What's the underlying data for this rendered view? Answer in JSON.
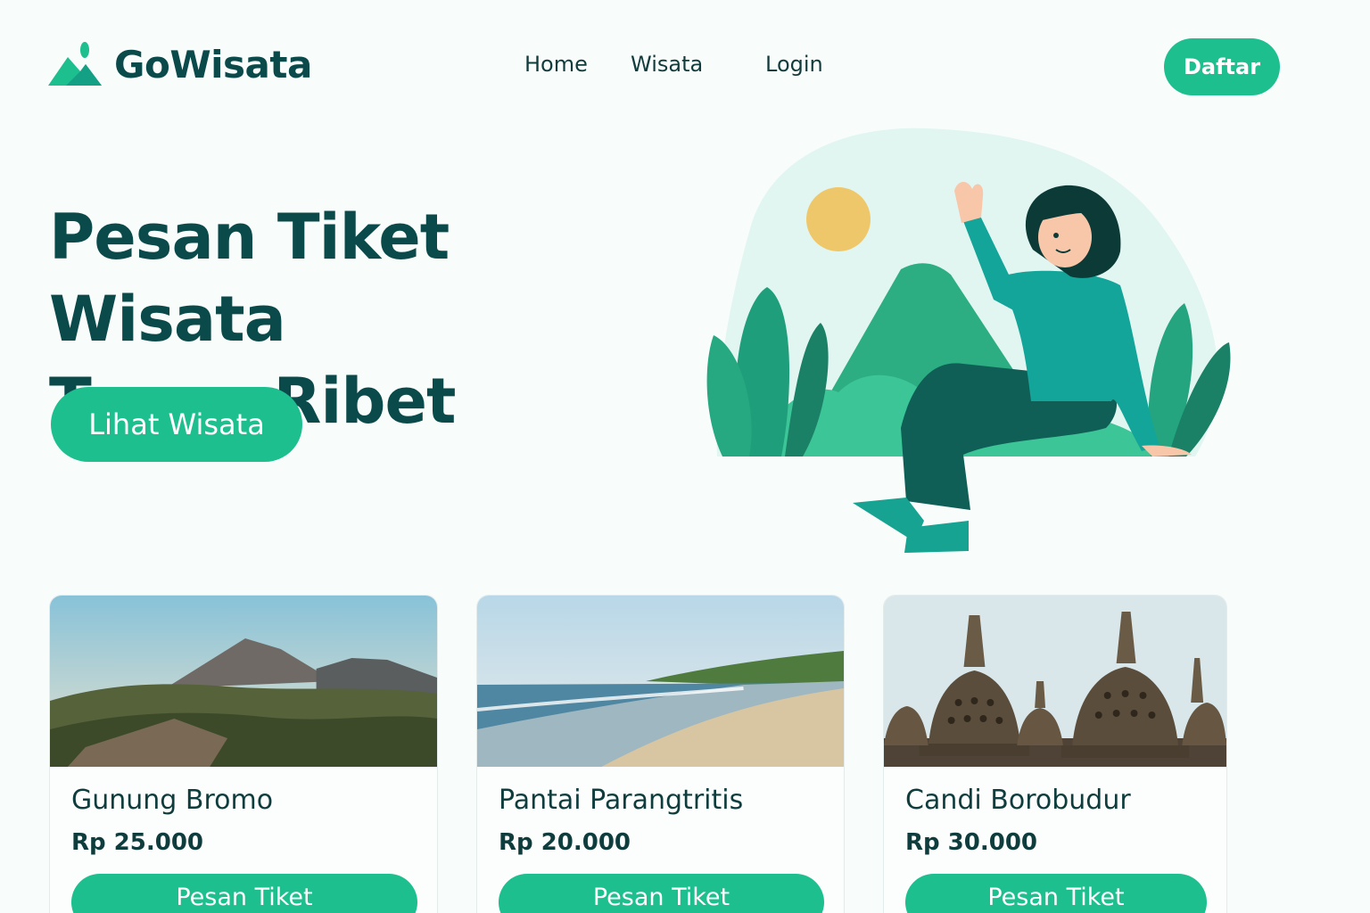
{
  "header": {
    "brand": "GoWisata",
    "nav": [
      {
        "label": "Home"
      },
      {
        "label": "Wisata"
      },
      {
        "label": "Login"
      }
    ],
    "cta_label": "Daftar"
  },
  "hero": {
    "title_line1": "Pesan Tiket Wisata",
    "title_line2": "Tanpa Ribet",
    "button_label": "Lihat Wisata"
  },
  "destinations": [
    {
      "name": "Gunung Bromo",
      "price": "Rp 25.000",
      "button": "Pesan Tiket",
      "image": "mountain-landscape"
    },
    {
      "name": "Pantai Parangtritis",
      "price": "Rp 20.000",
      "button": "Pesan Tiket",
      "image": "beach-landscape"
    },
    {
      "name": "Candi Borobudur",
      "price": "Rp 30.000",
      "button": "Pesan Tiket",
      "image": "temple-stupas"
    }
  ],
  "colors": {
    "primary": "#1dbf8e",
    "text_dark": "#0b4a4a",
    "background": "#f8fdfc"
  }
}
